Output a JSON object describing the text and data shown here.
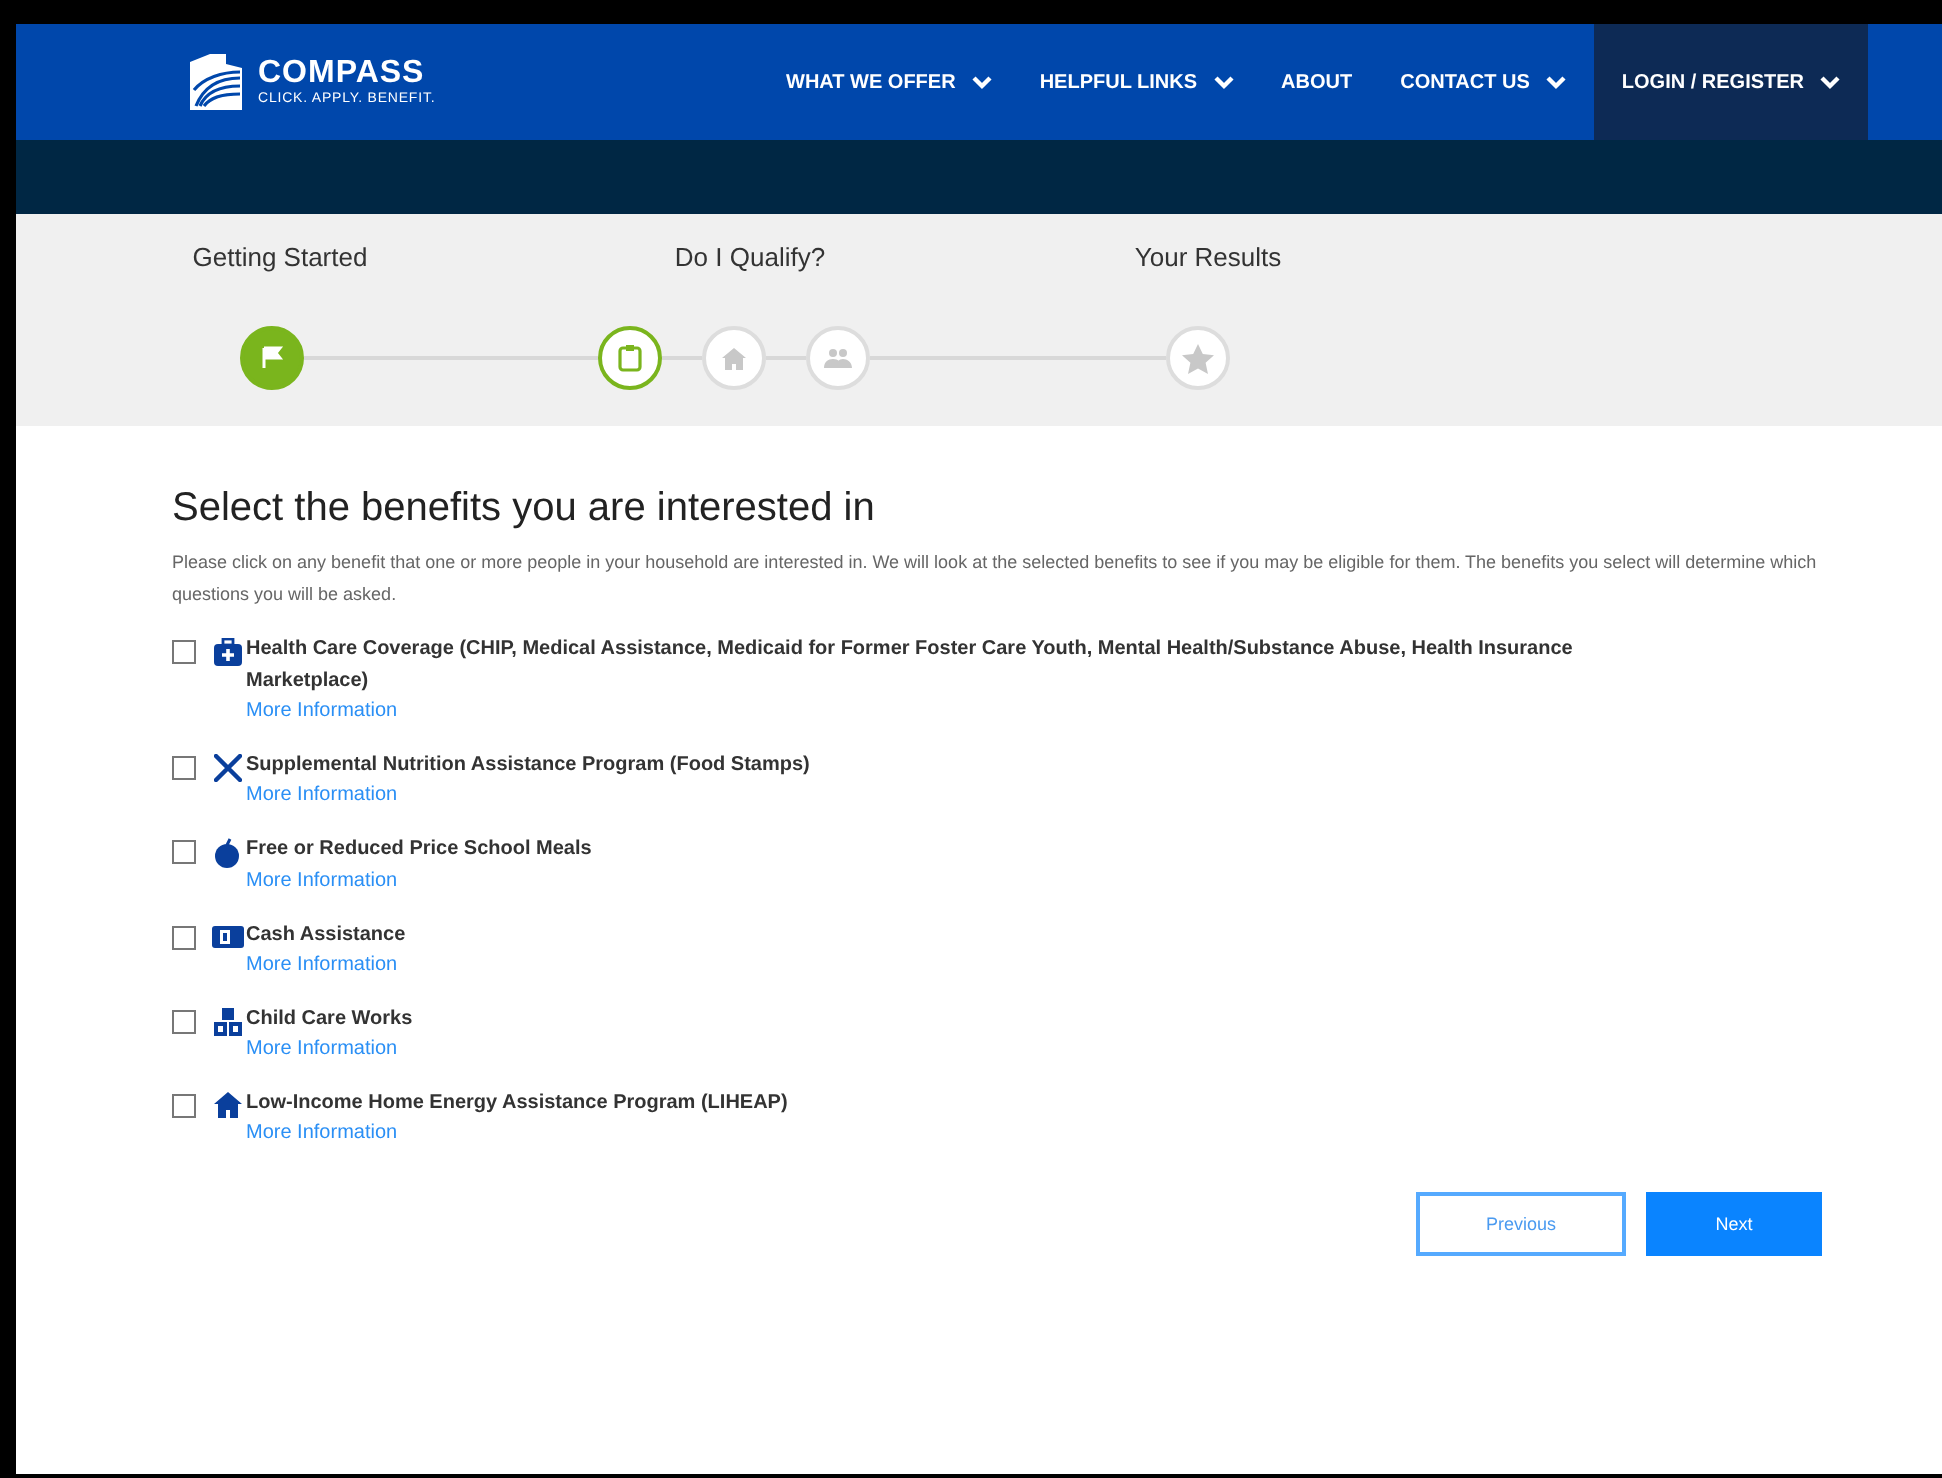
{
  "header": {
    "logo": {
      "name": "COMPASS",
      "tagline": "CLICK. APPLY. BENEFIT."
    },
    "nav": [
      {
        "label": "WHAT WE OFFER",
        "dropdown": true,
        "selected": false
      },
      {
        "label": "HELPFUL LINKS",
        "dropdown": true,
        "selected": false
      },
      {
        "label": "ABOUT",
        "dropdown": false,
        "selected": false
      },
      {
        "label": "CONTACT US",
        "dropdown": true,
        "selected": false
      },
      {
        "label": "LOGIN / REGISTER",
        "dropdown": true,
        "selected": true
      }
    ]
  },
  "progress": {
    "steps": [
      "Getting Started",
      "Do I Qualify?",
      "Your Results"
    ],
    "nodes": [
      {
        "kind": "flag",
        "completed": true,
        "current": false
      },
      {
        "kind": "clipboard",
        "completed": false,
        "current": true
      },
      {
        "kind": "home",
        "completed": false,
        "current": false
      },
      {
        "kind": "people",
        "completed": false,
        "current": false
      },
      {
        "kind": "star",
        "completed": false,
        "current": false
      }
    ]
  },
  "main": {
    "title": "Select the benefits you are interested in",
    "intro": "Please click on any benefit that one or more people in your household are interested in. We will look at the selected benefits to see if you may be eligible for them. The benefits you select will determine which questions you will be asked.",
    "benefits": [
      {
        "kind": "health",
        "label": "Health Care Coverage (CHIP, Medical Assistance, Medicaid for Former Foster Care Youth, Mental Health/Substance Abuse, Health Insurance Marketplace)",
        "link": "More Information",
        "checked": false
      },
      {
        "kind": "food",
        "label": "Supplemental Nutrition Assistance Program (Food Stamps)",
        "link": "More Information",
        "checked": false
      },
      {
        "kind": "apple",
        "label": "Free or Reduced Price School Meals",
        "link": "More Information",
        "checked": false
      },
      {
        "kind": "cash",
        "label": "Cash Assistance",
        "link": "More Information",
        "checked": false
      },
      {
        "kind": "blocks",
        "label": "Child Care Works",
        "link": "More Information",
        "checked": false
      },
      {
        "kind": "home",
        "label": "Low-Income Home Energy Assistance Program (LIHEAP)",
        "link": "More Information",
        "checked": false
      }
    ],
    "buttons": [
      {
        "kind": "secondary",
        "label": "Previous"
      },
      {
        "kind": "primary",
        "label": "Next"
      }
    ]
  }
}
